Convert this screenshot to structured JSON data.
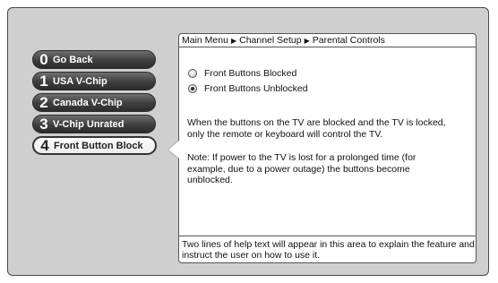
{
  "menu": {
    "items": [
      {
        "number": "0",
        "label": "Go Back",
        "active": false
      },
      {
        "number": "1",
        "label": "USA V-Chip",
        "active": false
      },
      {
        "number": "2",
        "label": "Canada V-Chip",
        "active": false
      },
      {
        "number": "3",
        "label": "V-Chip Unrated",
        "active": false
      },
      {
        "number": "4",
        "label": "Front Button Block",
        "active": true
      }
    ]
  },
  "breadcrumb": {
    "items": [
      "Main Menu",
      "Channel Setup",
      "Parental Controls"
    ],
    "separator": "▶"
  },
  "options": [
    {
      "label": "Front Buttons Blocked",
      "selected": false
    },
    {
      "label": "Front Buttons Unblocked",
      "selected": true
    }
  ],
  "content": {
    "description": "When the buttons on the TV are blocked and the TV is locked, only the remote or keyboard will control the TV.",
    "note": "Note: If power to the TV is lost for a prolonged time (for example, due to a power outage) the buttons become unblocked."
  },
  "help_text": "Two lines of help text will appear in this area to explain the feature and instruct the user on how to use it."
}
